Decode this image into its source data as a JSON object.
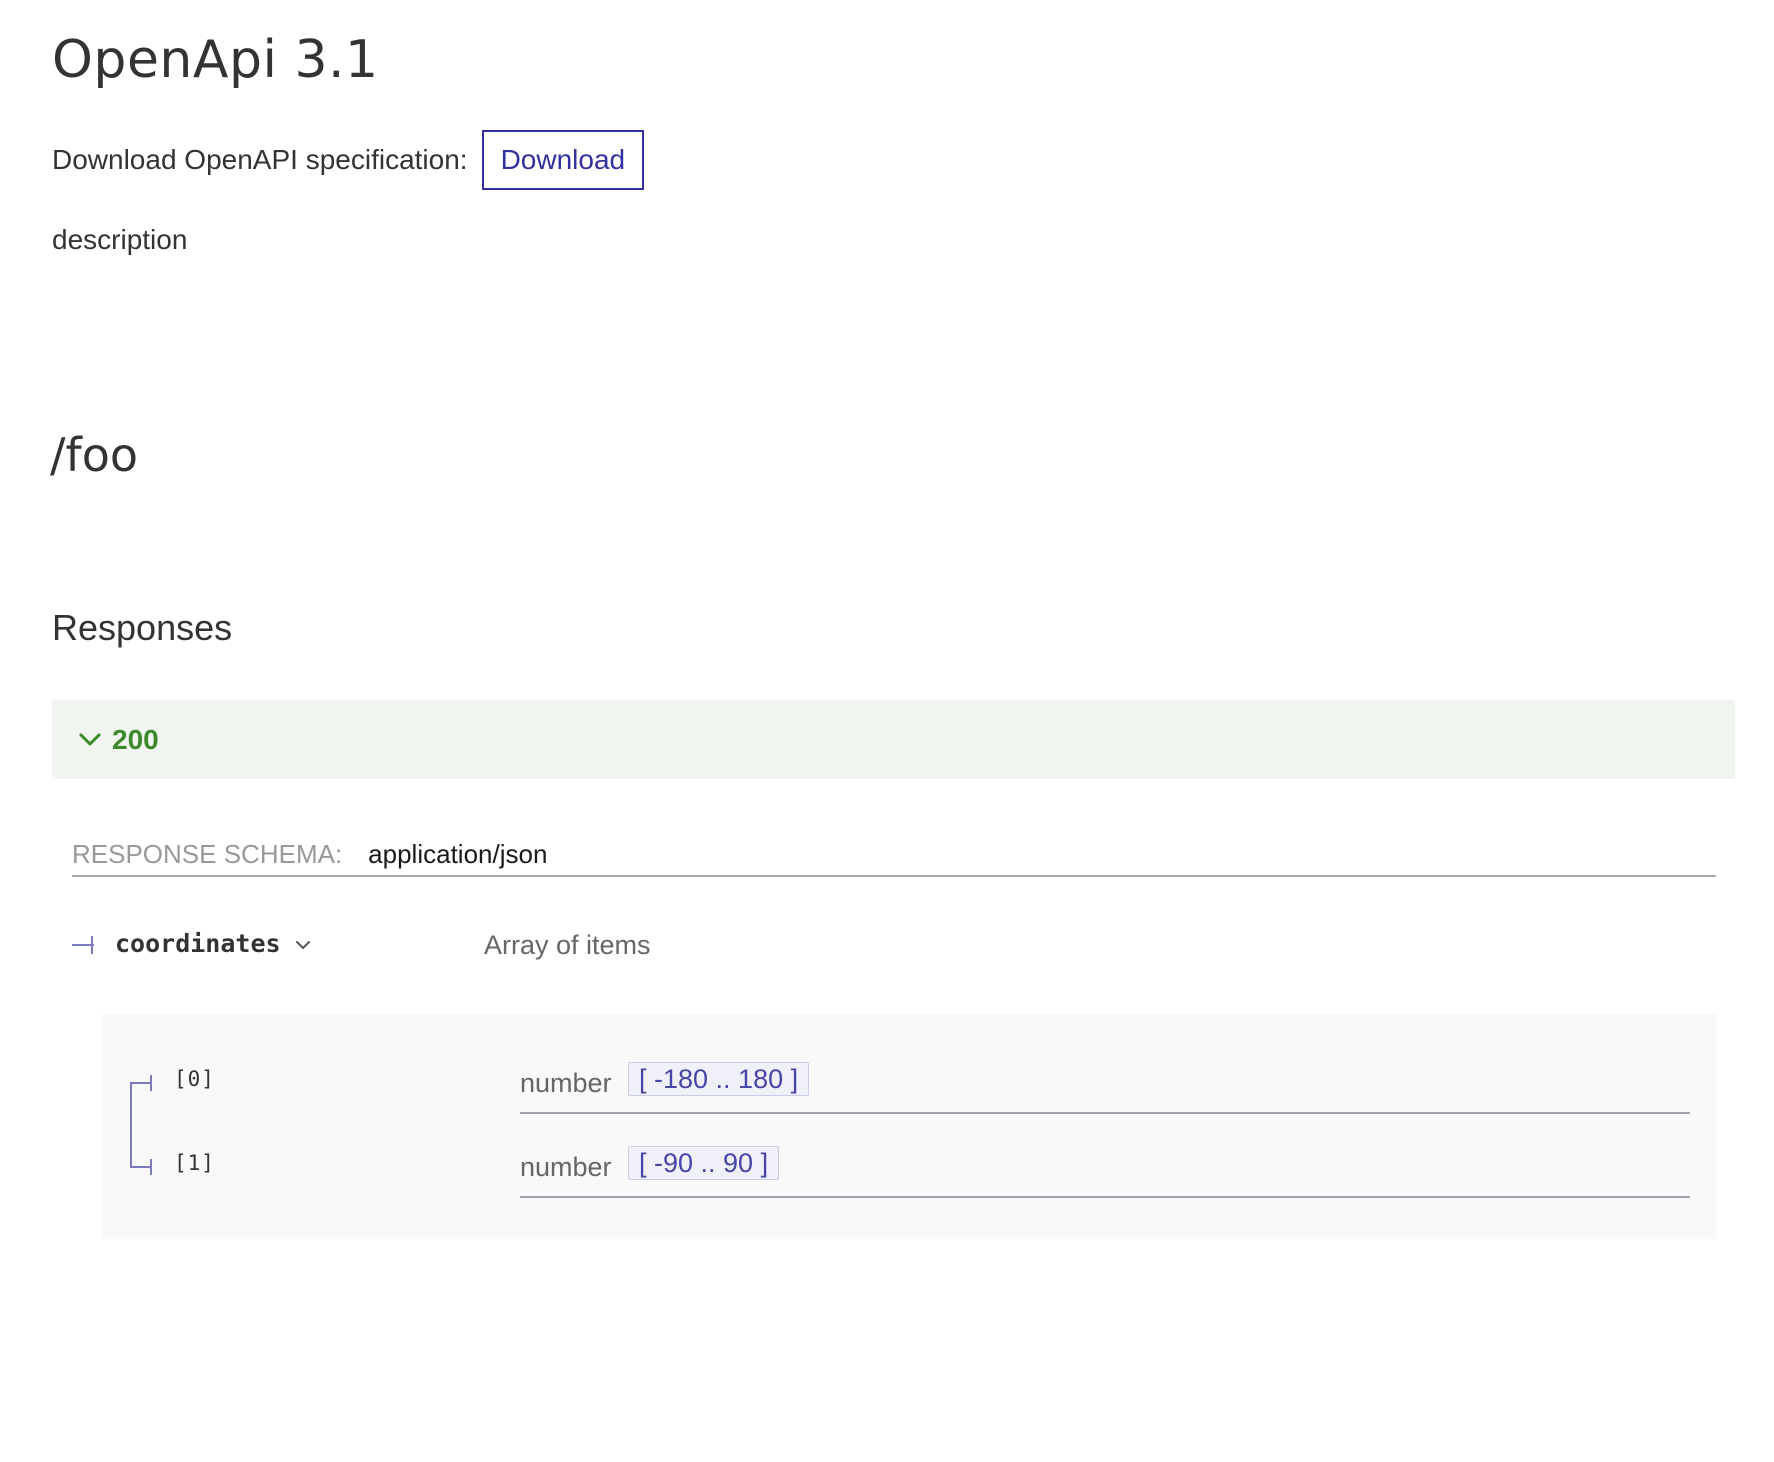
{
  "header": {
    "title": "OpenApi 3.1",
    "download_label": "Download OpenAPI specification:",
    "download_button": "Download",
    "description": "description"
  },
  "operation": {
    "path": "/foo",
    "responses_title": "Responses",
    "responses": [
      {
        "code": "200",
        "expanded": true,
        "status_color": "#3d8a2d"
      }
    ]
  },
  "schema": {
    "label": "Response Schema:",
    "content_type": "application/json",
    "property": {
      "name": "coordinates",
      "type": "Array of items",
      "items": [
        {
          "index": "[0]",
          "type": "number",
          "range": "[ -180 .. 180 ]"
        },
        {
          "index": "[1]",
          "type": "number",
          "range": "[ -90 .. 90 ]"
        }
      ]
    }
  },
  "icons": {
    "response_toggle": "chevron-down-icon",
    "property_toggle": "chevron-down-icon"
  },
  "colors": {
    "accent": "#32329f",
    "success": "#3d8a2d",
    "tree_line": "#7c7cbb"
  }
}
